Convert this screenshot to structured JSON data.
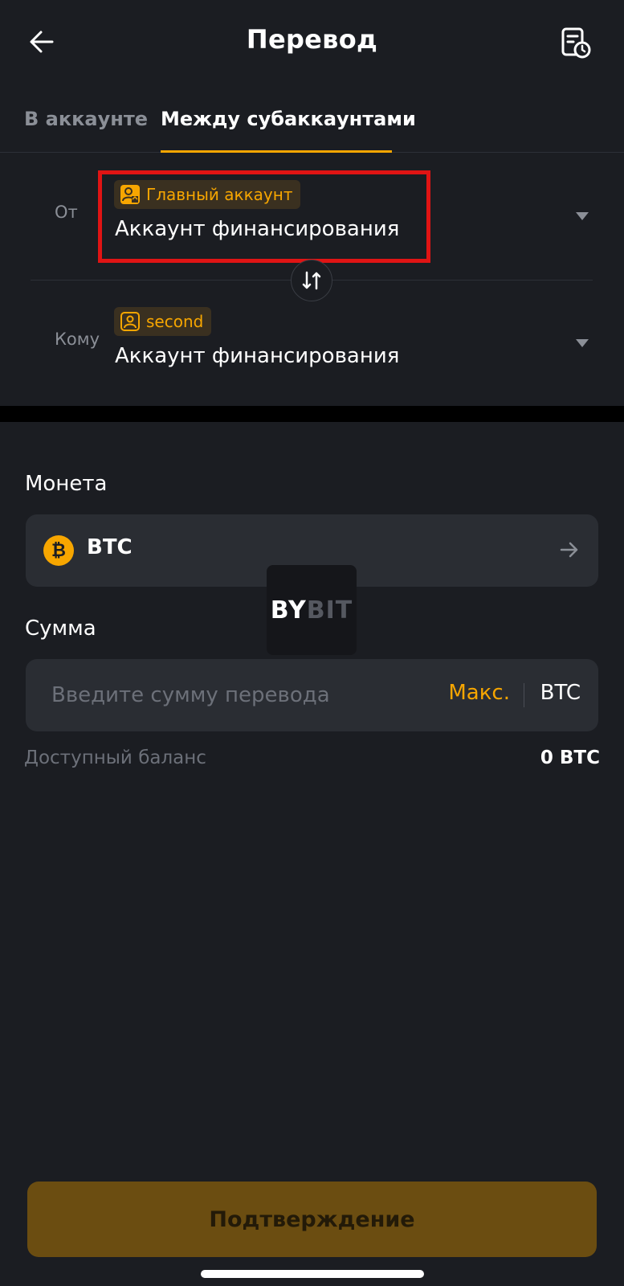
{
  "header": {
    "title": "Перевод"
  },
  "tabs": [
    {
      "label": "В аккаунте",
      "active": false
    },
    {
      "label": "Между субаккаунтами",
      "active": true
    }
  ],
  "from": {
    "label": "От",
    "badge": "Главный аккаунт",
    "account": "Аккаунт финансирования"
  },
  "to": {
    "label": "Кому",
    "badge": "second",
    "account": "Аккаунт финансирования"
  },
  "coin": {
    "label": "Монета",
    "selected": "BTC",
    "icon_symbol": "₿"
  },
  "amount": {
    "label": "Сумма",
    "placeholder": "Введите сумму перевода",
    "value": "",
    "max_label": "Макс.",
    "unit": "BTC"
  },
  "balance": {
    "label": "Доступный баланс",
    "value": "0 BTC"
  },
  "watermark": {
    "by": "BY",
    "bit": "BIT"
  },
  "confirm": {
    "label": "Подтверждение"
  },
  "colors": {
    "background": "#1b1d22",
    "accent": "#f7a600",
    "highlight": "#e01414",
    "confirm_disabled": "#6b4d11"
  }
}
